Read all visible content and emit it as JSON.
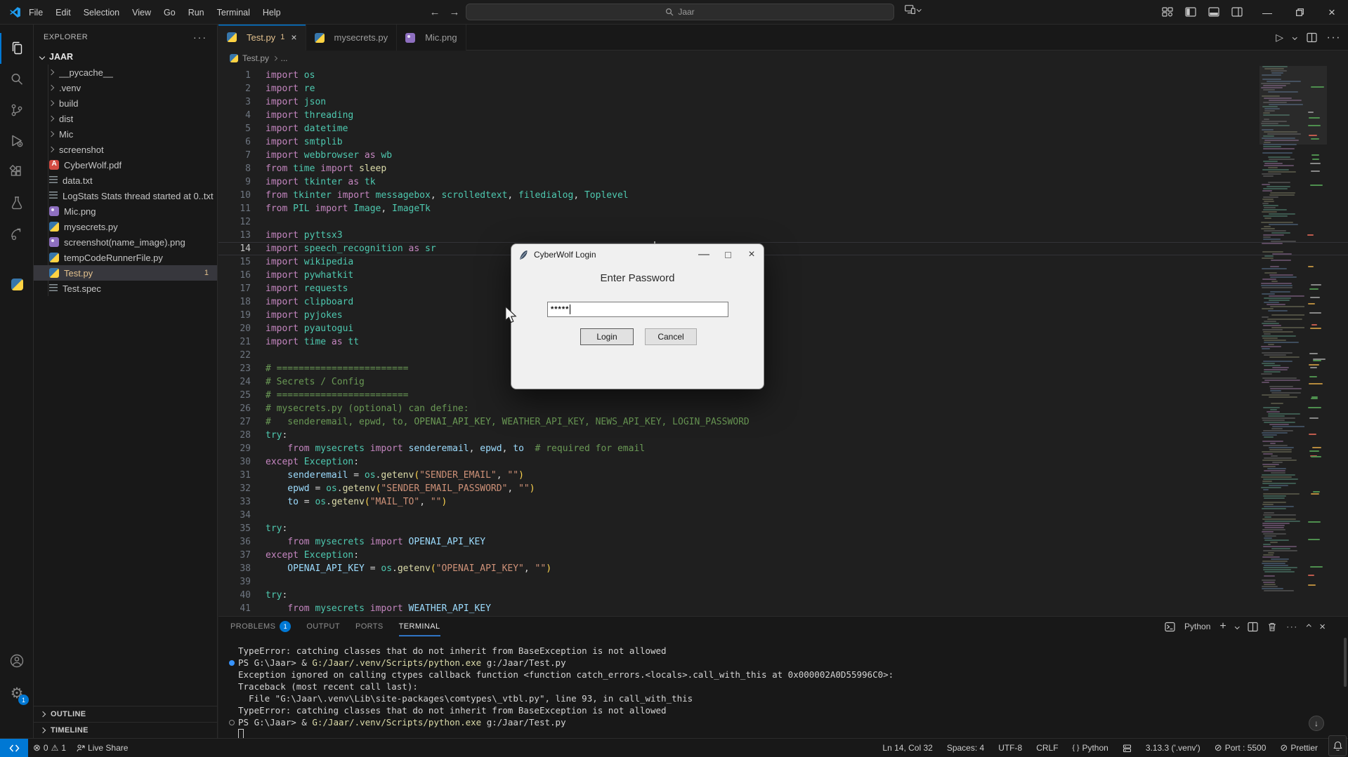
{
  "titlebar": {
    "menus": [
      "File",
      "Edit",
      "Selection",
      "View",
      "Go",
      "Run",
      "Terminal",
      "Help"
    ],
    "search_value": "Jaar",
    "back": "←",
    "forward": "→",
    "minimize": "—",
    "close": "×"
  },
  "tabs": [
    {
      "label": "Test.py",
      "dirty": "1",
      "close": "×"
    },
    {
      "label": "mysecrets.py"
    },
    {
      "label": "Mic.png"
    }
  ],
  "breadcrumb": {
    "file": "Test.py",
    "ellipsis": "..."
  },
  "sidebar": {
    "title": "EXPLORER",
    "more": "···",
    "root": "JAAR",
    "files": [
      {
        "label": "__pycache__",
        "type": "folder"
      },
      {
        "label": ".venv",
        "type": "folder"
      },
      {
        "label": "build",
        "type": "folder"
      },
      {
        "label": "dist",
        "type": "folder"
      },
      {
        "label": "Mic",
        "type": "folder"
      },
      {
        "label": "screenshot",
        "type": "folder"
      },
      {
        "label": "CyberWolf.pdf",
        "type": "pdf"
      },
      {
        "label": "data.txt",
        "type": "txt"
      },
      {
        "label": "LogStats Stats thread started at 0..txt",
        "type": "txt"
      },
      {
        "label": "Mic.png",
        "type": "img"
      },
      {
        "label": "mysecrets.py",
        "type": "py"
      },
      {
        "label": "screenshot(name_image).png",
        "type": "img"
      },
      {
        "label": "tempCodeRunnerFile.py",
        "type": "py"
      },
      {
        "label": "Test.py",
        "type": "py",
        "selected": true,
        "modified": true,
        "badge": "1"
      },
      {
        "label": "Test.spec",
        "type": "spec"
      }
    ],
    "sections": {
      "outline": "OUTLINE",
      "timeline": "TIMELINE"
    }
  },
  "editor": {
    "current_line": 14,
    "lines": [
      {
        "seg": [
          [
            "import",
            "k"
          ],
          [
            " os",
            "m"
          ]
        ]
      },
      {
        "seg": [
          [
            "import",
            "k"
          ],
          [
            " re",
            "m"
          ]
        ]
      },
      {
        "seg": [
          [
            "import",
            "k"
          ],
          [
            " json",
            "m"
          ]
        ]
      },
      {
        "seg": [
          [
            "import",
            "k"
          ],
          [
            " threading",
            "m"
          ]
        ]
      },
      {
        "seg": [
          [
            "import",
            "k"
          ],
          [
            " datetime",
            "m"
          ]
        ]
      },
      {
        "seg": [
          [
            "import",
            "k"
          ],
          [
            " smtplib",
            "m"
          ]
        ]
      },
      {
        "seg": [
          [
            "import",
            "k"
          ],
          [
            " webbrowser",
            "m"
          ],
          [
            " as",
            "k"
          ],
          [
            " wb",
            "m"
          ]
        ]
      },
      {
        "seg": [
          [
            "from",
            "k"
          ],
          [
            " time",
            "m"
          ],
          [
            " import",
            "k"
          ],
          [
            " sleep",
            "f"
          ]
        ]
      },
      {
        "seg": [
          [
            "import",
            "k"
          ],
          [
            " tkinter",
            "m"
          ],
          [
            " as",
            "k"
          ],
          [
            " tk",
            "m"
          ]
        ]
      },
      {
        "seg": [
          [
            "from",
            "k"
          ],
          [
            " tkinter",
            "m"
          ],
          [
            " import",
            "k"
          ],
          [
            " messagebox",
            "m"
          ],
          [
            ",",
            "w"
          ],
          [
            " scrolledtext",
            "m"
          ],
          [
            ",",
            "w"
          ],
          [
            " filedialog",
            "m"
          ],
          [
            ",",
            "w"
          ],
          [
            " Toplevel",
            "m"
          ]
        ]
      },
      {
        "seg": [
          [
            "from",
            "k"
          ],
          [
            " PIL",
            "m"
          ],
          [
            " import",
            "k"
          ],
          [
            " Image",
            "m"
          ],
          [
            ",",
            "w"
          ],
          [
            " ImageTk",
            "m"
          ]
        ]
      },
      {
        "seg": []
      },
      {
        "seg": [
          [
            "import",
            "k"
          ],
          [
            " pyttsx3",
            "m"
          ]
        ]
      },
      {
        "seg": [
          [
            "import",
            "k"
          ],
          [
            " speech_recognition",
            "m"
          ],
          [
            " as",
            "k"
          ],
          [
            " sr",
            "m"
          ]
        ]
      },
      {
        "seg": [
          [
            "import",
            "k"
          ],
          [
            " wikipedia",
            "m"
          ]
        ]
      },
      {
        "seg": [
          [
            "import",
            "k"
          ],
          [
            " pywhatkit",
            "m"
          ]
        ]
      },
      {
        "seg": [
          [
            "import",
            "k"
          ],
          [
            " requests",
            "m"
          ]
        ]
      },
      {
        "seg": [
          [
            "import",
            "k"
          ],
          [
            " clipboard",
            "m"
          ]
        ]
      },
      {
        "seg": [
          [
            "import",
            "k"
          ],
          [
            " pyjokes",
            "m"
          ]
        ]
      },
      {
        "seg": [
          [
            "import",
            "k"
          ],
          [
            " pyautogui",
            "m"
          ]
        ]
      },
      {
        "seg": [
          [
            "import",
            "k"
          ],
          [
            " time",
            "m"
          ],
          [
            " as",
            "k"
          ],
          [
            " tt",
            "m"
          ]
        ]
      },
      {
        "seg": []
      },
      {
        "seg": [
          [
            "# ========================",
            "c"
          ]
        ]
      },
      {
        "seg": [
          [
            "# Secrets / Config",
            "c"
          ]
        ]
      },
      {
        "seg": [
          [
            "# ========================",
            "c"
          ]
        ]
      },
      {
        "seg": [
          [
            "# mysecrets.py (optional) can define:",
            "c"
          ]
        ]
      },
      {
        "seg": [
          [
            "#   senderemail, epwd, to, OPENAI_API_KEY, WEATHER_API_KEY, NEWS_API_KEY, LOGIN_PASSWORD",
            "c"
          ]
        ]
      },
      {
        "seg": [
          [
            "try",
            "m"
          ],
          [
            ":",
            "w"
          ]
        ]
      },
      {
        "seg": [
          [
            "    from",
            "k"
          ],
          [
            " mysecrets",
            "m"
          ],
          [
            " import",
            "k"
          ],
          [
            " senderemail",
            "v"
          ],
          [
            ",",
            "w"
          ],
          [
            " epwd",
            "v"
          ],
          [
            ",",
            "w"
          ],
          [
            " to",
            "v"
          ],
          [
            "  # required for email",
            "c"
          ]
        ]
      },
      {
        "seg": [
          [
            "except",
            "k"
          ],
          [
            " Exception",
            "m"
          ],
          [
            ":",
            "w"
          ]
        ]
      },
      {
        "seg": [
          [
            "    senderemail",
            "v"
          ],
          [
            " = ",
            "w"
          ],
          [
            "os",
            "m"
          ],
          [
            ".",
            "w"
          ],
          [
            "getenv",
            "f"
          ],
          [
            "(",
            "b"
          ],
          [
            "\"SENDER_EMAIL\"",
            "s"
          ],
          [
            ", ",
            "w"
          ],
          [
            "\"\"",
            "s"
          ],
          [
            ")",
            "b"
          ]
        ]
      },
      {
        "seg": [
          [
            "    epwd",
            "v"
          ],
          [
            " = ",
            "w"
          ],
          [
            "os",
            "m"
          ],
          [
            ".",
            "w"
          ],
          [
            "getenv",
            "f"
          ],
          [
            "(",
            "b"
          ],
          [
            "\"SENDER_EMAIL_PASSWORD\"",
            "s"
          ],
          [
            ", ",
            "w"
          ],
          [
            "\"\"",
            "s"
          ],
          [
            ")",
            "b"
          ]
        ]
      },
      {
        "seg": [
          [
            "    to",
            "v"
          ],
          [
            " = ",
            "w"
          ],
          [
            "os",
            "m"
          ],
          [
            ".",
            "w"
          ],
          [
            "getenv",
            "f"
          ],
          [
            "(",
            "b"
          ],
          [
            "\"MAIL_TO\"",
            "s"
          ],
          [
            ", ",
            "w"
          ],
          [
            "\"\"",
            "s"
          ],
          [
            ")",
            "b"
          ]
        ]
      },
      {
        "seg": []
      },
      {
        "seg": [
          [
            "try",
            "m"
          ],
          [
            ":",
            "w"
          ]
        ]
      },
      {
        "seg": [
          [
            "    from",
            "k"
          ],
          [
            " mysecrets",
            "m"
          ],
          [
            " import",
            "k"
          ],
          [
            " OPENAI_API_KEY",
            "v"
          ]
        ]
      },
      {
        "seg": [
          [
            "except",
            "k"
          ],
          [
            " Exception",
            "m"
          ],
          [
            ":",
            "w"
          ]
        ]
      },
      {
        "seg": [
          [
            "    OPENAI_API_KEY",
            "v"
          ],
          [
            " = ",
            "w"
          ],
          [
            "os",
            "m"
          ],
          [
            ".",
            "w"
          ],
          [
            "getenv",
            "f"
          ],
          [
            "(",
            "b"
          ],
          [
            "\"OPENAI_API_KEY\"",
            "s"
          ],
          [
            ", ",
            "w"
          ],
          [
            "\"\"",
            "s"
          ],
          [
            ")",
            "b"
          ]
        ]
      },
      {
        "seg": []
      },
      {
        "seg": [
          [
            "try",
            "m"
          ],
          [
            ":",
            "w"
          ]
        ]
      },
      {
        "seg": [
          [
            "    from",
            "k"
          ],
          [
            " mysecrets",
            "m"
          ],
          [
            " import",
            "k"
          ],
          [
            " WEATHER_API_KEY",
            "v"
          ]
        ]
      }
    ]
  },
  "dialog": {
    "title": "CyberWolf Login",
    "heading": "Enter Password",
    "password_value": "*****",
    "login_label": "Login",
    "cancel_label": "Cancel",
    "minimize": "—",
    "close": "×"
  },
  "panel": {
    "tabs": [
      {
        "label": "PROBLEMS",
        "badge": "1"
      },
      {
        "label": "OUTPUT"
      },
      {
        "label": "PORTS"
      },
      {
        "label": "TERMINAL",
        "active": true
      }
    ],
    "shell_label": "Python",
    "terminal_lines": [
      {
        "seg": [
          [
            "TypeError: catching classes that do not inherit from BaseException is not allowed",
            "w"
          ]
        ]
      },
      {
        "marker": "dot",
        "seg": [
          [
            "PS G:\\Jaar> & ",
            "w"
          ],
          [
            "G:/Jaar/.venv/Scripts/python.exe",
            "y"
          ],
          [
            " g:/Jaar/Test.py",
            "w"
          ]
        ]
      },
      {
        "seg": [
          [
            "Exception ignored on calling ctypes callback function <function catch_errors.<locals>.call_with_this at 0x000002A0D55996C0>:",
            "w"
          ]
        ]
      },
      {
        "seg": [
          [
            "Traceback (most recent call last):",
            "w"
          ]
        ]
      },
      {
        "seg": [
          [
            "  File \"G:\\Jaar\\.venv\\Lib\\site-packages\\comtypes\\_vtbl.py\", line 93, in call_with_this",
            "w"
          ]
        ]
      },
      {
        "seg": [
          [
            "TypeError: catching classes that do not inherit from BaseException is not allowed",
            "w"
          ]
        ]
      },
      {
        "marker": "circle",
        "seg": [
          [
            "PS G:\\Jaar> & ",
            "w"
          ],
          [
            "G:/Jaar/.venv/Scripts/python.exe",
            "y"
          ],
          [
            " g:/Jaar/Test.py",
            "w"
          ]
        ]
      },
      {
        "cursor": true,
        "seg": []
      }
    ]
  },
  "statusbar": {
    "errors": "0",
    "warnings": "1",
    "live_share": "Live Share",
    "right_items": [
      {
        "label": "Ln 14, Col 32"
      },
      {
        "label": "Spaces: 4"
      },
      {
        "label": "UTF-8"
      },
      {
        "label": "CRLF"
      },
      {
        "icon": "braces",
        "label": "Python"
      },
      {
        "icon": "server",
        "label": ""
      },
      {
        "label": "3.13.3 ('.venv')"
      },
      {
        "icon": "slash",
        "label": "Port : 5500"
      },
      {
        "icon": "slash",
        "label": "Prettier"
      }
    ]
  }
}
